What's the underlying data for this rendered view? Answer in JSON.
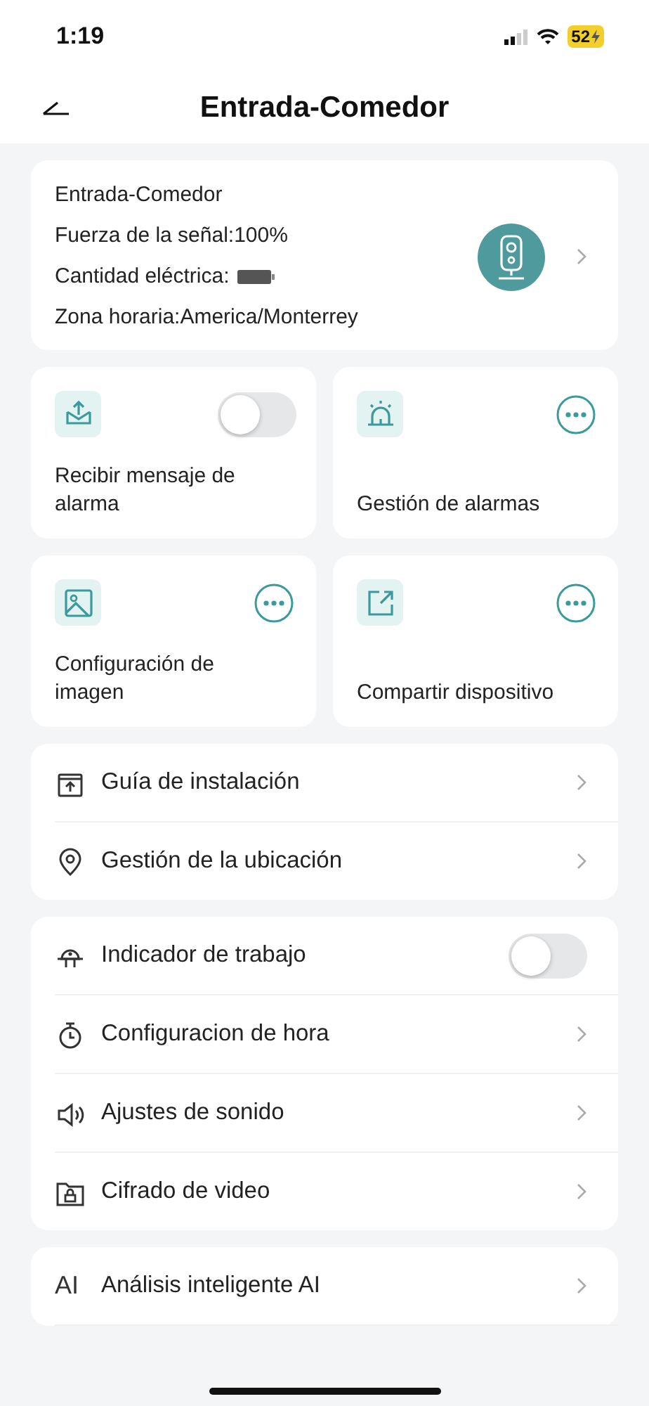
{
  "status_bar": {
    "time": "1:19",
    "battery": "52"
  },
  "header": {
    "title": "Entrada-Comedor"
  },
  "device_card": {
    "name": "Entrada-Comedor",
    "signal": "Fuerza de la señal:100%",
    "power_label": "Cantidad eléctrica:",
    "timezone": "Zona horaria:America/Monterrey"
  },
  "tiles": [
    {
      "label": "Recibir mensaje de alarma",
      "kind": "toggle",
      "on": false
    },
    {
      "label": "Gestión de alarmas",
      "kind": "more"
    },
    {
      "label": "Configuración de imagen",
      "kind": "more"
    },
    {
      "label": "Compartir dispositivo",
      "kind": "more"
    }
  ],
  "groups": [
    {
      "items": [
        {
          "label": "Guía de instalación",
          "kind": "link"
        },
        {
          "label": "Gestión de la ubicación",
          "kind": "link"
        }
      ]
    },
    {
      "items": [
        {
          "label": "Indicador de trabajo",
          "kind": "toggle",
          "on": false
        },
        {
          "label": "Configuracion de hora",
          "kind": "link"
        },
        {
          "label": "Ajustes de sonido",
          "kind": "link"
        },
        {
          "label": "Cifrado de video",
          "kind": "link"
        }
      ]
    },
    {
      "items": [
        {
          "label": "Análisis inteligente AI",
          "kind": "link",
          "icon_text": "AI"
        }
      ]
    }
  ]
}
